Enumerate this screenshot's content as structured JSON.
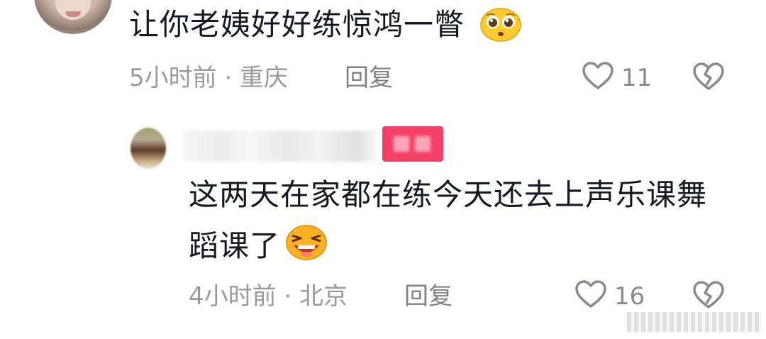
{
  "comments": [
    {
      "text": "让你老姨好好练惊鸿一瞥",
      "emoji": "pleading-face",
      "time_location": "5小时前 · 重庆",
      "reply_label": "回复",
      "likes": "11"
    },
    {
      "username": "",
      "badge": "",
      "text_line1": "这两天在家都在练今天还去上声乐课舞",
      "text_line2": "蹈课了",
      "emoji": "laughing-face",
      "time_location": "4小时前 · 北京",
      "reply_label": "回复",
      "likes": "16"
    }
  ],
  "colors": {
    "text": "#161823",
    "meta": "#9a9ba2",
    "badge": "#f43f66",
    "icon": "#8a8b92"
  },
  "icons": [
    "heart-icon",
    "dislike-broken-heart-icon"
  ]
}
